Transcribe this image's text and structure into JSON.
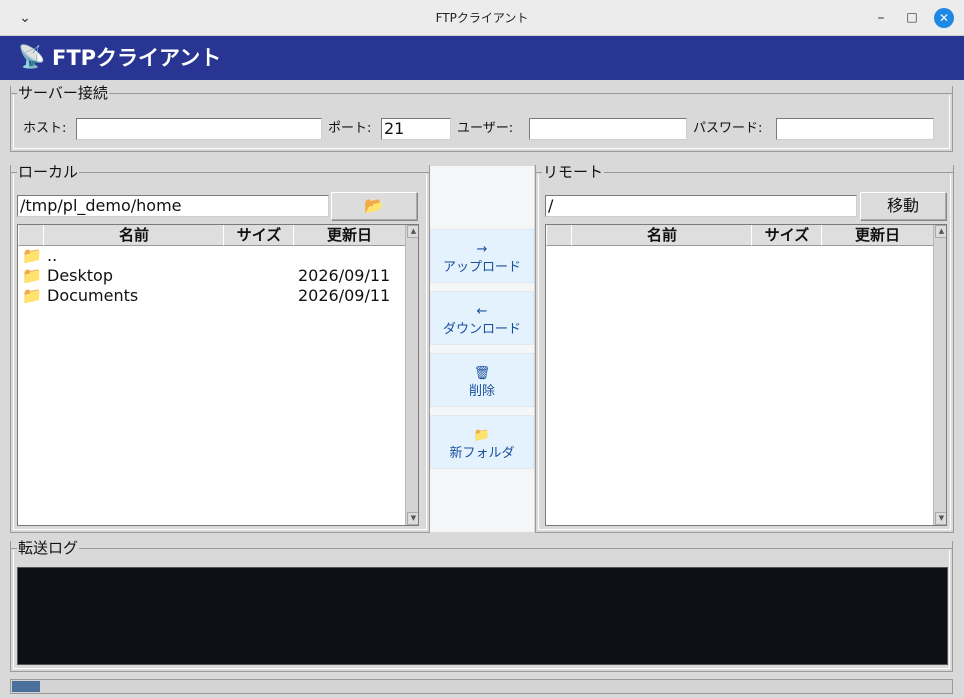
{
  "window": {
    "title": "FTPクライアント",
    "menu_glyph": "⌄",
    "minimize_glyph": "–",
    "maximize_glyph": "□",
    "close_glyph": "✕"
  },
  "header": {
    "icon": "📡",
    "title": "FTPクライアント",
    "bg_color": "#283593"
  },
  "connection": {
    "legend": "サーバー接続",
    "host_label": "ホスト:",
    "host_value": "",
    "port_label": "ポート:",
    "port_value": "21",
    "user_label": "ユーザー:",
    "user_value": "",
    "password_label": "パスワード:",
    "password_value": ""
  },
  "local": {
    "legend": "ローカル",
    "path": "/tmp/pl_demo/home",
    "browse_icon": "📂",
    "columns": [
      "名前",
      "サイズ",
      "更新日"
    ],
    "rows": [
      {
        "icon": "📁",
        "name": "..",
        "size": "",
        "date": ""
      },
      {
        "icon": "📁",
        "name": "Desktop",
        "size": "",
        "date": "2026/09/11"
      },
      {
        "icon": "📁",
        "name": "Documents",
        "size": "",
        "date": "2026/09/11"
      }
    ]
  },
  "actions": [
    {
      "icon": "→",
      "label": "アップロード"
    },
    {
      "icon": "←",
      "label": "ダウンロード"
    },
    {
      "icon": "🗑",
      "label": "削除"
    },
    {
      "icon": "📁",
      "label": "新フォルダ"
    }
  ],
  "remote": {
    "legend": "リモート",
    "path": "/",
    "go_label": "移動",
    "columns": [
      "名前",
      "サイズ",
      "更新日"
    ]
  },
  "log": {
    "legend": "転送ログ",
    "bg_color": "#0d1117"
  },
  "progress": {
    "percent": 3
  }
}
